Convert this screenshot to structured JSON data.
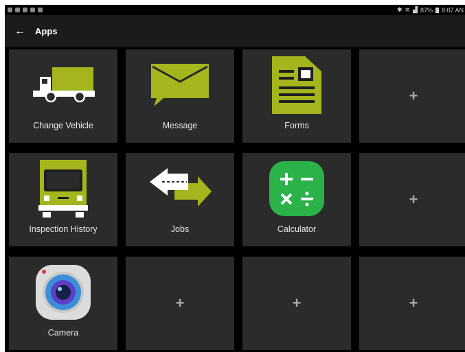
{
  "status_bar": {
    "battery": "87%",
    "time": "8:07 AN"
  },
  "app_bar": {
    "back_icon": "arrow-left-icon",
    "title": "Apps"
  },
  "tiles": [
    {
      "label": "Change Vehicle",
      "icon": "truck-icon"
    },
    {
      "label": "Message",
      "icon": "envelope-icon"
    },
    {
      "label": "Forms",
      "icon": "document-icon"
    },
    {
      "label": "+",
      "icon": "plus-icon"
    },
    {
      "label": "Inspection History",
      "icon": "truck-front-icon"
    },
    {
      "label": "Jobs",
      "icon": "double-arrow-icon"
    },
    {
      "label": "Calculator",
      "icon": "calculator-icon"
    },
    {
      "label": "+",
      "icon": "plus-icon"
    },
    {
      "label": "Camera",
      "icon": "camera-icon"
    },
    {
      "label": "+",
      "icon": "plus-icon"
    },
    {
      "label": "+",
      "icon": "plus-icon"
    },
    {
      "label": "+",
      "icon": "plus-icon"
    }
  ],
  "colors": {
    "accent": "#a5b51d",
    "tile_bg": "#2b2b2b",
    "app_bar_bg": "#1b1b1b",
    "calculator_green": "#2bb34a"
  }
}
